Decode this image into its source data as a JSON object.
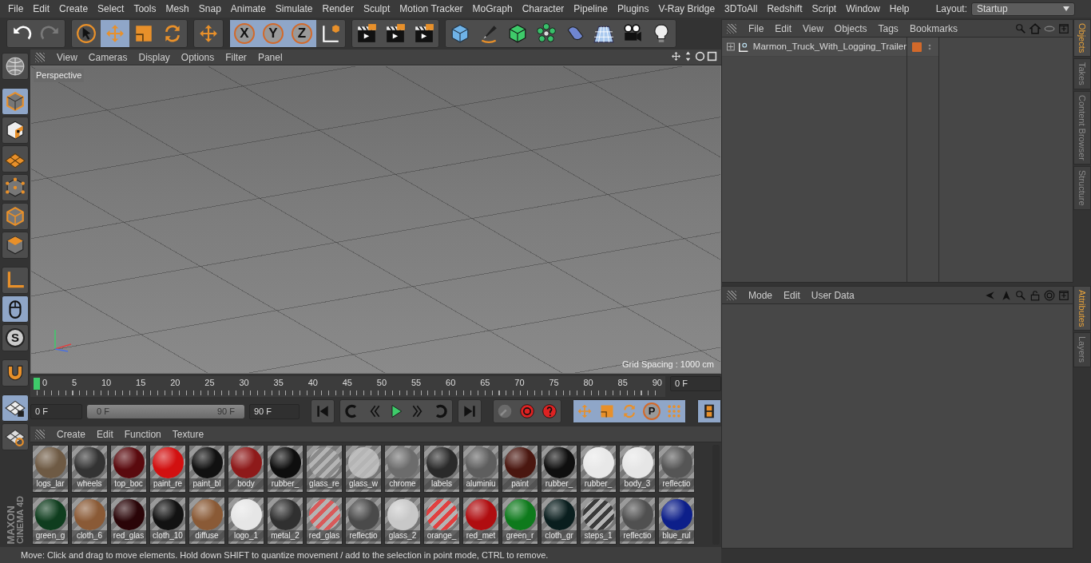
{
  "menu": [
    "File",
    "Edit",
    "Create",
    "Select",
    "Tools",
    "Mesh",
    "Snap",
    "Animate",
    "Simulate",
    "Render",
    "Sculpt",
    "Motion Tracker",
    "MoGraph",
    "Character",
    "Pipeline",
    "Plugins",
    "V-Ray Bridge",
    "3DToAll",
    "Redshift",
    "Script",
    "Window",
    "Help"
  ],
  "layout": {
    "label": "Layout:",
    "value": "Startup"
  },
  "toolbar": [
    [
      {
        "selected": false,
        "disabled": false
      },
      {
        "selected": false,
        "disabled": true
      }
    ],
    [
      {
        "selected": false,
        "disabled": false
      },
      {
        "selected": true,
        "disabled": false
      },
      {
        "selected": false,
        "disabled": false
      },
      {
        "selected": false,
        "disabled": false
      }
    ],
    [
      {
        "selected": false,
        "disabled": false
      }
    ],
    [
      {
        "label": "X",
        "selected": true,
        "disabled": false
      },
      {
        "label": "Y",
        "selected": true,
        "disabled": false
      },
      {
        "label": "Z",
        "selected": true,
        "disabled": false
      },
      {
        "selected": false,
        "disabled": false
      }
    ],
    [
      {
        "selected": false,
        "disabled": false
      },
      {
        "selected": false,
        "disabled": false
      },
      {
        "selected": false,
        "disabled": false
      }
    ],
    [
      {
        "selected": false,
        "disabled": false
      },
      {
        "selected": false,
        "disabled": false
      },
      {
        "selected": false,
        "disabled": false
      },
      {
        "selected": false,
        "disabled": false
      },
      {
        "selected": false,
        "disabled": false
      },
      {
        "selected": false,
        "disabled": false
      },
      {
        "selected": false,
        "disabled": false
      },
      {
        "selected": false,
        "disabled": false
      }
    ]
  ],
  "left_toolbar": [
    {
      "selected": false
    },
    {
      "selected": true
    },
    {
      "selected": false
    },
    {
      "selected": false
    },
    {
      "selected": false
    },
    {
      "selected": false
    },
    {
      "selected": false
    },
    {
      "selected": false
    },
    {
      "selected": true
    },
    {
      "label": "S",
      "selected": false
    },
    {
      "selected": false
    },
    {
      "selected": true
    },
    {
      "selected": false
    }
  ],
  "brand": [
    "MAXON",
    "CINEMA 4D"
  ],
  "viewport": {
    "menu": [
      "View",
      "Cameras",
      "Display",
      "Options",
      "Filter",
      "Panel"
    ],
    "camera": "Perspective",
    "grid_spacing": "Grid Spacing : 1000 cm"
  },
  "timeline": {
    "ticks": [
      "0",
      "5",
      "10",
      "15",
      "20",
      "25",
      "30",
      "35",
      "40",
      "45",
      "50",
      "55",
      "60",
      "65",
      "70",
      "75",
      "80",
      "85",
      "90"
    ],
    "playhead": {
      "level": 0
    },
    "current_frame": "0 F",
    "start_field": "0 F",
    "range": {
      "start": "0 F",
      "end": "90 F",
      "level": 1
    },
    "end_field": "90 F",
    "key_tools": [
      {
        "selected": true
      },
      {
        "selected": true
      },
      {
        "selected": true
      },
      {
        "label": "P",
        "selected": true
      },
      {
        "selected": true
      }
    ],
    "film": {
      "selected": true
    }
  },
  "materials": {
    "menu": [
      "Create",
      "Edit",
      "Function",
      "Texture"
    ],
    "items": [
      {
        "name": "logs_lar",
        "kind": "solid",
        "color": "#6e5a44"
      },
      {
        "name": "wheels",
        "kind": "solid",
        "color": "#333333"
      },
      {
        "name": "top_boc",
        "kind": "solid",
        "color": "#5a0a0e"
      },
      {
        "name": "paint_re",
        "kind": "solid",
        "color": "#d21010"
      },
      {
        "name": "paint_bl",
        "kind": "solid",
        "color": "#111111"
      },
      {
        "name": "body",
        "kind": "solid",
        "color": "#8e1a1a"
      },
      {
        "name": "rubber_",
        "kind": "solid",
        "color": "#0e0e0e"
      },
      {
        "name": "glass_re",
        "kind": "glass",
        "color": "#8a8a8a"
      },
      {
        "name": "glass_w",
        "kind": "glass",
        "color": "#bdbdbd"
      },
      {
        "name": "chrome",
        "kind": "solid",
        "color": "#6c6c6c"
      },
      {
        "name": "labels",
        "kind": "solid",
        "color": "#2a2a2a"
      },
      {
        "name": "aluminiu",
        "kind": "solid",
        "color": "#5e5e5e"
      },
      {
        "name": "paint",
        "kind": "solid",
        "color": "#4a1710"
      },
      {
        "name": "rubber_",
        "kind": "solid",
        "color": "#0f0f0f"
      },
      {
        "name": "rubber_",
        "kind": "solid",
        "color": "#e8e8e8"
      },
      {
        "name": "body_3",
        "kind": "solid",
        "color": "#e6e6e6"
      },
      {
        "name": "reflectio",
        "kind": "solid",
        "color": "#555555"
      },
      {
        "name": "green_g",
        "kind": "solid",
        "color": "#0f3d1e"
      },
      {
        "name": "cloth_6",
        "kind": "solid",
        "color": "#8a5a36"
      },
      {
        "name": "red_glas",
        "kind": "solid",
        "color": "#2a0508"
      },
      {
        "name": "cloth_10",
        "kind": "solid",
        "color": "#121212"
      },
      {
        "name": "diffuse",
        "kind": "solid",
        "color": "#8a5a36"
      },
      {
        "name": "logo_1",
        "kind": "solid",
        "color": "#e6e6e6"
      },
      {
        "name": "metal_2",
        "kind": "solid",
        "color": "#303030"
      },
      {
        "name": "red_glas",
        "kind": "glass",
        "color": "#d85a5a"
      },
      {
        "name": "reflectio",
        "kind": "solid",
        "color": "#4a4a4a"
      },
      {
        "name": "glass_2",
        "kind": "solid",
        "color": "#c8c8c8"
      },
      {
        "name": "orange_",
        "kind": "glass",
        "color": "#e04040"
      },
      {
        "name": "red_met",
        "kind": "solid",
        "color": "#b00d10"
      },
      {
        "name": "green_r",
        "kind": "solid",
        "color": "#0e7a1c"
      },
      {
        "name": "cloth_gr",
        "kind": "solid",
        "color": "#0a1e1e"
      },
      {
        "name": "steps_1",
        "kind": "glass",
        "color": "#3a3a3a"
      },
      {
        "name": "reflectio",
        "kind": "solid",
        "color": "#505050"
      },
      {
        "name": "blue_rul",
        "kind": "solid",
        "color": "#0d1f8a"
      }
    ]
  },
  "status_bar": "Move: Click and drag to move elements. Hold down SHIFT to quantize movement / add to the selection in point mode, CTRL to remove.",
  "objects": {
    "menu": [
      "File",
      "Edit",
      "View",
      "Objects",
      "Tags",
      "Bookmarks"
    ],
    "items": [
      {
        "name": "Marmon_Truck_With_Logging_Trailer",
        "expanded": false,
        "color": "#d2692a"
      }
    ]
  },
  "objects_tabs": [
    {
      "label": "Objects",
      "selected": true
    },
    {
      "label": "Takes",
      "selected": false
    },
    {
      "label": "Content Browser",
      "selected": false
    },
    {
      "label": "Structure",
      "selected": false
    }
  ],
  "attributes": {
    "menu": [
      "Mode",
      "Edit",
      "User Data"
    ]
  },
  "attributes_tabs": [
    {
      "label": "Attributes",
      "selected": true
    },
    {
      "label": "Layers",
      "selected": false
    }
  ]
}
